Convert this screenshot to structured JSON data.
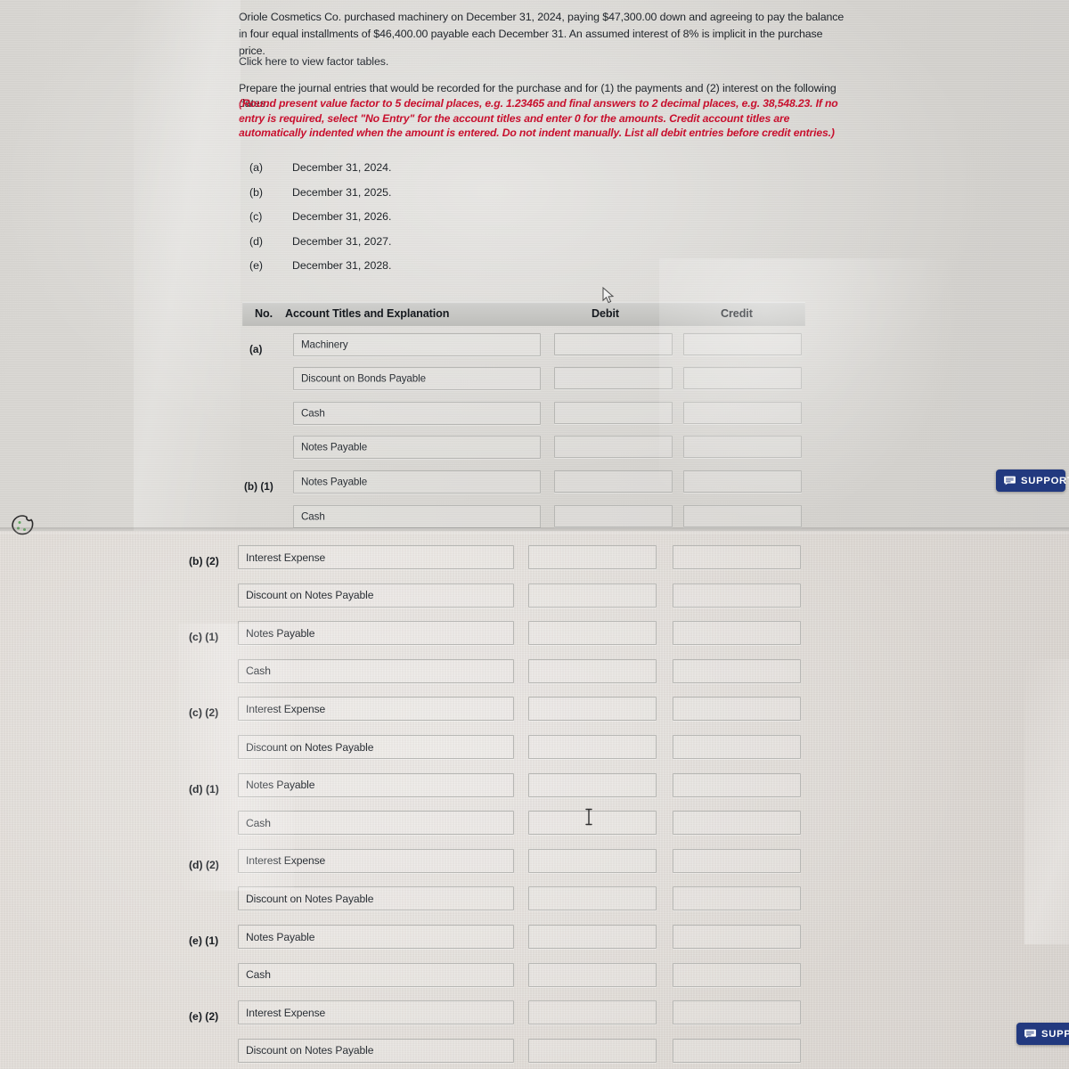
{
  "problem": {
    "stem": "Oriole Cosmetics Co. purchased machinery on December 31, 2024, paying $47,300.00 down and agreeing to pay the balance in four equal installments of $46,400.00 payable each December 31. An assumed interest of 8% is implicit in the purchase price.",
    "factor_tables_link": "Click here to view factor tables.",
    "instruction_lead": "Prepare the journal entries that would be recorded for the purchase and for (1) the payments and (2) interest on the following dates.",
    "instruction_note": "(Round present value factor to 5 decimal places, e.g. 1.23465 and final answers to 2 decimal places, e.g. 38,548.23. If no entry is required, select \"No Entry\" for the account titles and enter 0 for the amounts. Credit account titles are automatically indented when the amount is entered. Do not indent manually. List all debit entries before credit entries.)",
    "dates": [
      {
        "label": "(a)",
        "value": "December 31, 2024."
      },
      {
        "label": "(b)",
        "value": "December 31, 2025."
      },
      {
        "label": "(c)",
        "value": "December 31, 2026."
      },
      {
        "label": "(d)",
        "value": "December 31, 2027."
      },
      {
        "label": "(e)",
        "value": "December 31, 2028."
      }
    ]
  },
  "journal": {
    "headers": {
      "no": "No.",
      "titles": "Account Titles and Explanation",
      "debit": "Debit",
      "credit": "Credit"
    },
    "rows_top": [
      {
        "no": "(a)",
        "account": "Machinery",
        "debit": "",
        "credit": ""
      },
      {
        "no": "",
        "account": "Discount on Bonds Payable",
        "debit": "",
        "credit": ""
      },
      {
        "no": "",
        "account": "Cash",
        "debit": "",
        "credit": ""
      },
      {
        "no": "",
        "account": "Notes Payable",
        "debit": "",
        "credit": ""
      },
      {
        "no": "(b) (1)",
        "account": "Notes Payable",
        "debit": "",
        "credit": ""
      },
      {
        "no": "",
        "account": "Cash",
        "debit": "",
        "credit": ""
      }
    ],
    "rows_bottom": [
      {
        "no": "(b) (2)",
        "account": "Interest Expense",
        "debit": "",
        "credit": ""
      },
      {
        "no": "",
        "account": "Discount on Notes Payable",
        "debit": "",
        "credit": ""
      },
      {
        "no": "(c) (1)",
        "account": "Notes Payable",
        "debit": "",
        "credit": ""
      },
      {
        "no": "",
        "account": "Cash",
        "debit": "",
        "credit": ""
      },
      {
        "no": "(c) (2)",
        "account": "Interest Expense",
        "debit": "",
        "credit": ""
      },
      {
        "no": "",
        "account": "Discount on Notes Payable",
        "debit": "",
        "credit": ""
      },
      {
        "no": "(d) (1)",
        "account": "Notes Payable",
        "debit": "",
        "credit": ""
      },
      {
        "no": "",
        "account": "Cash",
        "debit": "",
        "credit": ""
      },
      {
        "no": "(d) (2)",
        "account": "Interest Expense",
        "debit": "",
        "credit": ""
      },
      {
        "no": "",
        "account": "Discount on Notes Payable",
        "debit": "",
        "credit": ""
      },
      {
        "no": "(e) (1)",
        "account": "Notes Payable",
        "debit": "",
        "credit": ""
      },
      {
        "no": "",
        "account": "Cash",
        "debit": "",
        "credit": ""
      },
      {
        "no": "(e) (2)",
        "account": "Interest Expense",
        "debit": "",
        "credit": ""
      },
      {
        "no": "",
        "account": "Discount on Notes Payable",
        "debit": "",
        "credit": ""
      }
    ]
  },
  "support": {
    "label_full": "SUPPORT",
    "label_cropped": "SUPPO",
    "icon": "chat-bubble-icon"
  },
  "icons": {
    "cookie": "cookie-icon",
    "mouse_pointer": "mouse-pointer-cursor",
    "text_caret": "text-ibeam-cursor"
  },
  "colors": {
    "support_blue": "#22397f",
    "instruction_red": "#c8102e",
    "header_gray": "#c6c6c3",
    "field_border": "#b7b7b4"
  }
}
